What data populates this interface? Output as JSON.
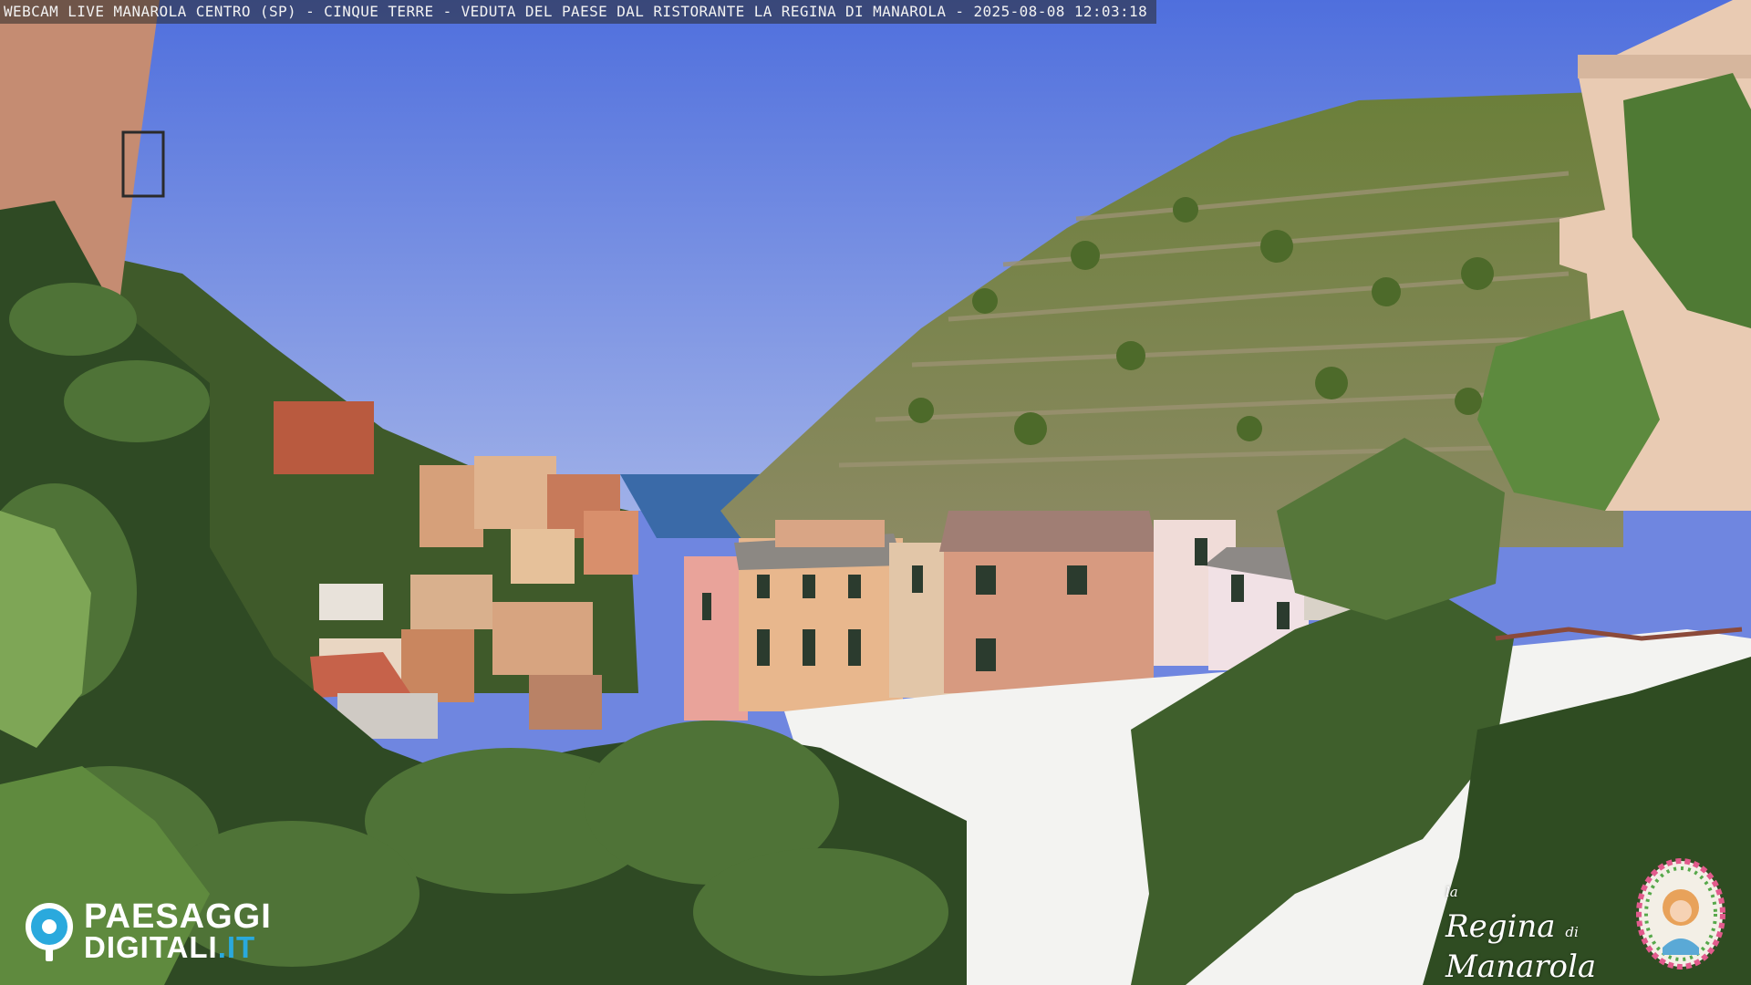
{
  "webcam": {
    "caption": "WEBCAM LIVE MANAROLA CENTRO (SP) - CINQUE TERRE - VEDUTA DEL PAESE DAL RISTORANTE LA REGINA DI MANAROLA - 2025-08-08 12:03:18"
  },
  "logos": {
    "paesaggi_line1": "PAESAGGI",
    "paesaggi_line2_a": "DIGITALI",
    "paesaggi_line2_b": ".IT",
    "regina_line1": "la",
    "regina_line2": "Regina",
    "regina_line3": "di",
    "regina_line4": "Manarola"
  },
  "colors": {
    "sky": "#6f86e0",
    "sea": "#3a6aa8",
    "brand_blue": "#2aa9dd"
  }
}
